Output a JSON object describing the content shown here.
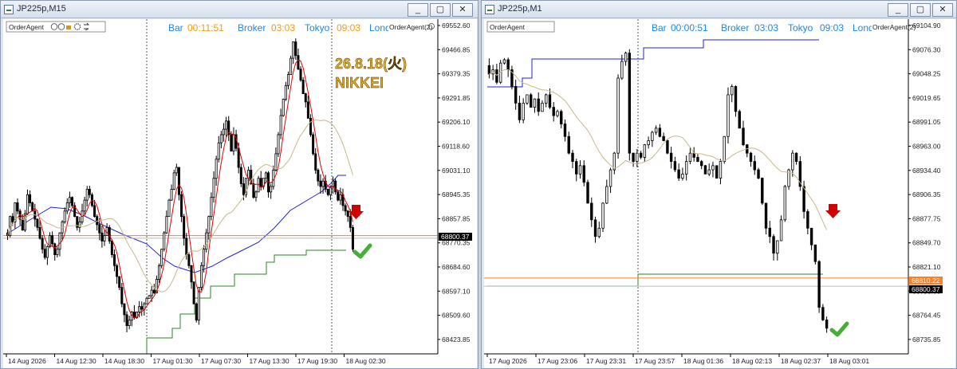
{
  "windows": [
    {
      "title": "JP225p,M15",
      "controls": [
        "_",
        "▢",
        "✕"
      ],
      "toolbar": {
        "ea_label": "OrderAgent",
        "icons": [
          "info-icon",
          "face-icon",
          "lock-icon",
          "gear-icon",
          "arrows-icon"
        ]
      },
      "info": {
        "bar": "Bar",
        "bar_time": "00:11:51",
        "broker": "Broker",
        "broker_time": "03:03",
        "tokyo": "Tokyo",
        "tokyo_time": "09:03",
        "london": "London"
      },
      "ea_tag": "OrderAgent(2)",
      "annotation": {
        "date": "26.8.18(火)",
        "market": "NIKKEI"
      },
      "price_label_1": "68800.37",
      "price_label_2": "",
      "colors": {
        "up_arrow_signal": "#d00000",
        "check": "#44b035",
        "fast_ma": "#e00000",
        "slow_ma": "#c8b98a",
        "blue_line": "#2222dd",
        "green_line": "#2a8a2a",
        "orange_line": "#ff7f27",
        "price_label_bg": "#000000"
      }
    },
    {
      "title": "JP225p,M1",
      "controls": [
        "_",
        "▢",
        "✕"
      ],
      "toolbar": {
        "ea_label": "OrderAgent"
      },
      "info": {
        "bar": "Bar",
        "bar_time": "00:00:51",
        "broker": "Broker",
        "broker_time": "03:03",
        "tokyo": "Tokyo",
        "tokyo_time": "09:03",
        "london": "London"
      },
      "ea_tag": "OrderAgent(2)",
      "price_label_1": "68810.22",
      "price_label_2": "68800.37",
      "colors": {
        "price_label_orange_bg": "#ff7f27",
        "price_label_bg": "#000000"
      }
    }
  ],
  "chart_data": [
    {
      "type": "candlestick",
      "symbol": "JP225p",
      "timeframe": "M15",
      "y_ticks": [
        "69552.60",
        "69466.85",
        "69379.35",
        "69291.85",
        "69206.10",
        "69118.60",
        "69031.10",
        "68945.35",
        "68857.85",
        "68770.35",
        "68684.60",
        "68597.10",
        "68509.60",
        "68423.85"
      ],
      "x_ticks": [
        "14 Aug 2026",
        "14 Aug 12:30",
        "14 Aug 18:30",
        "17 Aug 01:30",
        "17 Aug 07:30",
        "17 Aug 13:30",
        "17 Aug 19:30",
        "18 Aug 02:30"
      ],
      "ylim": [
        68400,
        69580
      ],
      "current_price": 68800.37,
      "close_path": [
        68810,
        68880,
        68860,
        68930,
        68900,
        68870,
        68830,
        68890,
        68960,
        68930,
        68900,
        68870,
        68840,
        68800,
        68760,
        68730,
        68770,
        68810,
        68780,
        68740,
        68760,
        68820,
        68860,
        68900,
        68930,
        68950,
        68920,
        68880,
        68840,
        68860,
        68900,
        68940,
        68980,
        68960,
        68920,
        68880,
        68850,
        68820,
        68790,
        68810,
        68840,
        68790,
        68740,
        68700,
        68660,
        68620,
        68560,
        68520,
        68480,
        68500,
        68530,
        68510,
        68530,
        68550,
        68540,
        68560,
        68580,
        68590,
        68610,
        68600,
        68650,
        68700,
        68760,
        68820,
        68880,
        68940,
        68980,
        69040,
        69060,
        68960,
        68880,
        68800,
        68740,
        68700,
        68640,
        68560,
        68500,
        68620,
        68700,
        68760,
        68820,
        68880,
        68950,
        69020,
        69090,
        69150,
        69180,
        69200,
        69230,
        69180,
        69120,
        69180,
        69130,
        69060,
        69000,
        68960,
        69020,
        69050,
        69000,
        68950,
        68970,
        69020,
        68990,
        69020,
        69040,
        68970,
        68990,
        69050,
        69110,
        69180,
        69250,
        69310,
        69360,
        69400,
        69460,
        69520,
        69470,
        69420,
        69380,
        69330,
        69300,
        69240,
        69180,
        69110,
        69050,
        69010,
        68990,
        69010,
        68980,
        68960,
        68990,
        69010,
        68970,
        68940,
        68960,
        68920,
        68900,
        68880,
        68840,
        68760
      ]
    },
    {
      "type": "candlestick",
      "symbol": "JP225p",
      "timeframe": "M1",
      "y_ticks": [
        "69104.90",
        "69076.30",
        "69048.25",
        "69019.65",
        "68991.05",
        "68963.00",
        "68934.40",
        "68906.35",
        "68877.75",
        "68849.70",
        "68821.10",
        "68793.05",
        "68764.45",
        "68735.85"
      ],
      "x_ticks": [
        "17 Aug 2026",
        "17 Aug 23:06",
        "17 Aug 23:31",
        "17 Aug 23:57",
        "18 Aug 01:36",
        "18 Aug 02:13",
        "18 Aug 02:37",
        "18 Aug 03:01"
      ],
      "ylim": [
        68725,
        69115
      ],
      "current_price": 68800.37,
      "close_path": [
        69055,
        69060,
        69045,
        69068,
        69072,
        69060,
        69040,
        69020,
        69000,
        69020,
        69030,
        69015,
        69025,
        69010,
        69020,
        69030,
        69015,
        69005,
        69010,
        68995,
        68980,
        68960,
        68950,
        68935,
        68945,
        68925,
        68900,
        68880,
        68860,
        68870,
        68900,
        68920,
        68940,
        68960,
        69050,
        69070,
        69080,
        68960,
        68950,
        68960,
        68955,
        68970,
        68975,
        68985,
        68990,
        68980,
        68975,
        68960,
        68950,
        68940,
        68930,
        68935,
        68950,
        68960,
        68955,
        68950,
        68945,
        68935,
        68940,
        68945,
        68930,
        68950,
        68980,
        69030,
        69040,
        69010,
        68990,
        68970,
        68960,
        68950,
        68940,
        68930,
        68900,
        68870,
        68860,
        68840,
        68855,
        68880,
        68920,
        68940,
        68960,
        68950,
        68920,
        68890,
        68870,
        68850,
        68830,
        68775,
        68760,
        68750
      ]
    }
  ]
}
